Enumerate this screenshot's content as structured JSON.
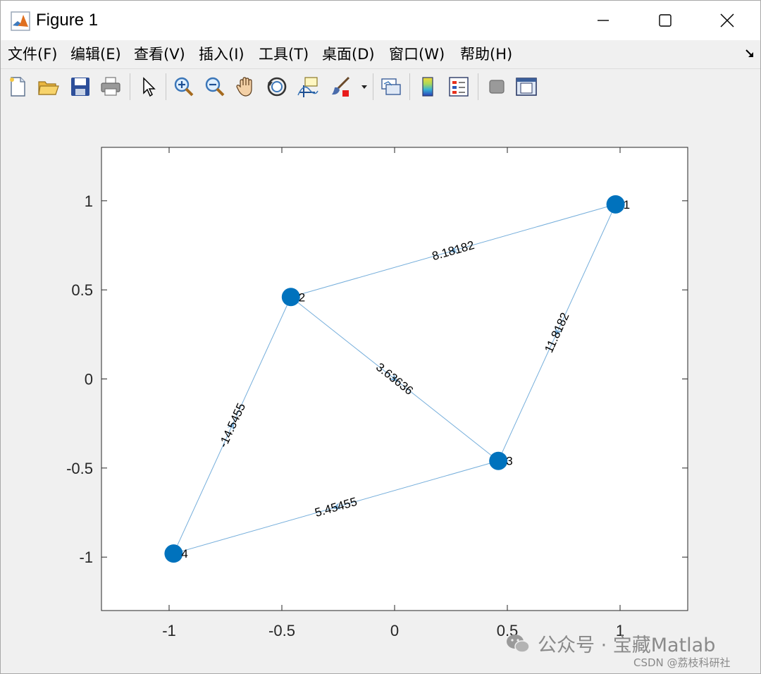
{
  "window": {
    "title": "Figure 1"
  },
  "menu": {
    "items": [
      "文件(F)",
      "编辑(E)",
      "查看(V)",
      "插入(I)",
      "工具(T)",
      "桌面(D)",
      "窗口(W)",
      "帮助(H)"
    ]
  },
  "toolbar": {
    "buttons": [
      "new-figure-icon",
      "open-file-icon",
      "save-icon",
      "print-icon",
      "pointer-arrow-icon",
      "zoom-in-icon",
      "zoom-out-icon",
      "pan-hand-icon",
      "rotate-3d-icon",
      "data-cursor-icon",
      "brush-icon",
      "brush-dropdown-icon",
      "link-plot-icon",
      "colorbar-icon",
      "legend-icon",
      "hide-plot-tools-icon",
      "show-plot-tools-icon"
    ]
  },
  "colors": {
    "node": "#0072BD",
    "edge": "#75AEDB",
    "axis": "#262626",
    "window_bg": "#f0f0f0"
  },
  "chart_data": {
    "type": "graph",
    "xlim": [
      -1.3,
      1.3
    ],
    "ylim": [
      -1.3,
      1.3
    ],
    "xticks": [
      -1,
      -0.5,
      0,
      0.5,
      1
    ],
    "yticks": [
      -1,
      -0.5,
      0,
      0.5,
      1
    ],
    "xtick_labels": [
      "-1",
      "-0.5",
      "0",
      "0.5",
      "1"
    ],
    "ytick_labels": [
      "-1",
      "-0.5",
      "0",
      "0.5",
      "1"
    ],
    "grid": false,
    "directed": true,
    "nodes": [
      {
        "id": "1",
        "x": 0.98,
        "y": 0.98
      },
      {
        "id": "2",
        "x": -0.46,
        "y": 0.46
      },
      {
        "id": "3",
        "x": 0.46,
        "y": -0.46
      },
      {
        "id": "4",
        "x": -0.98,
        "y": -0.98
      }
    ],
    "edges": [
      {
        "from": "1",
        "to": "2",
        "label": "8.18182"
      },
      {
        "from": "1",
        "to": "3",
        "label": "11.8182"
      },
      {
        "from": "2",
        "to": "3",
        "label": "3.63636"
      },
      {
        "from": "4",
        "to": "2",
        "label": "-14.5455"
      },
      {
        "from": "3",
        "to": "4",
        "label": "5.45455"
      }
    ]
  },
  "watermark": {
    "text": "公众号 · 宝藏Matlab",
    "credit": "CSDN @荔枝科研社"
  }
}
